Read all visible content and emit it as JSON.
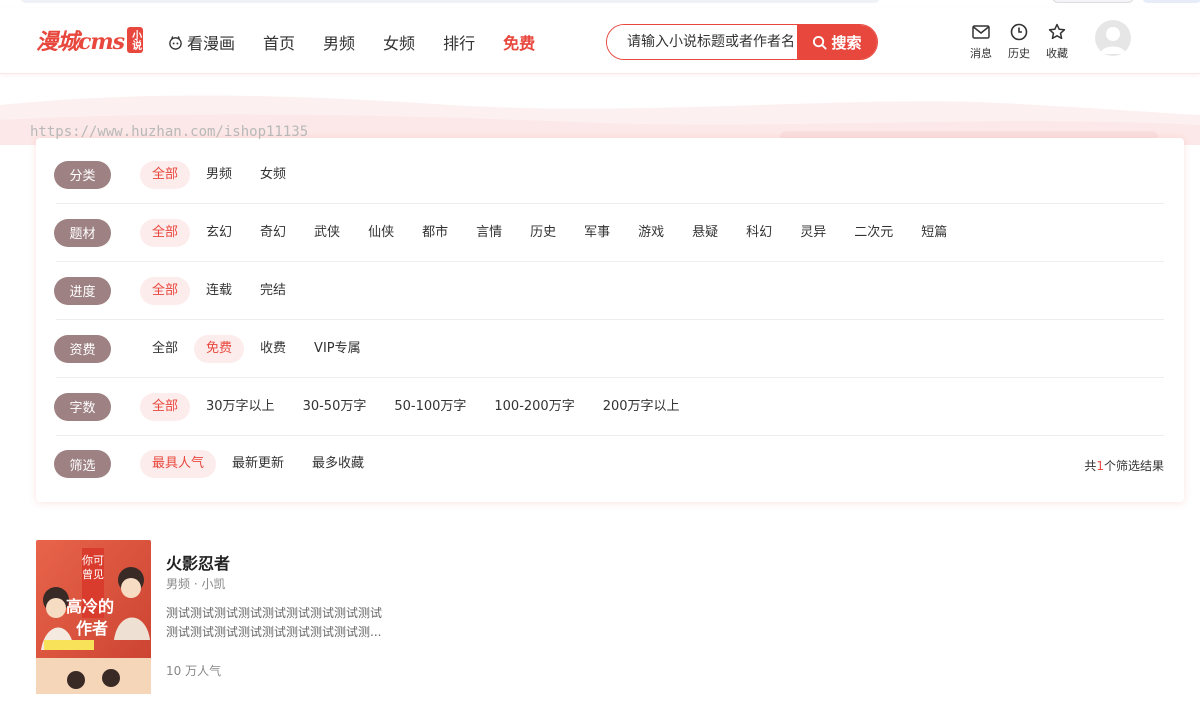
{
  "header": {
    "logo_text": "漫城cms",
    "logo_badge": "小说",
    "nav": [
      {
        "label": "看漫画",
        "icon": "comic-icon"
      },
      {
        "label": "首页"
      },
      {
        "label": "男频"
      },
      {
        "label": "女频"
      },
      {
        "label": "排行"
      },
      {
        "label": "免费",
        "active": true
      }
    ],
    "search": {
      "placeholder": "请输入小说标题或者作者名",
      "button": "搜索"
    },
    "tools": [
      {
        "label": "消息",
        "icon": "mail-icon"
      },
      {
        "label": "历史",
        "icon": "clock-icon"
      },
      {
        "label": "收藏",
        "icon": "star-icon"
      }
    ]
  },
  "watermark": "https://www.huzhan.com/ishop11135",
  "filters": {
    "category": {
      "label": "分类",
      "options": [
        "全部",
        "男频",
        "女频"
      ],
      "selected": "全部"
    },
    "theme": {
      "label": "题材",
      "options": [
        "全部",
        "玄幻",
        "奇幻",
        "武侠",
        "仙侠",
        "都市",
        "言情",
        "历史",
        "军事",
        "游戏",
        "悬疑",
        "科幻",
        "灵异",
        "二次元",
        "短篇"
      ],
      "selected": "全部"
    },
    "progress": {
      "label": "进度",
      "options": [
        "全部",
        "连载",
        "完结"
      ],
      "selected": "全部"
    },
    "fee": {
      "label": "资费",
      "options": [
        "全部",
        "免费",
        "收费",
        "VIP专属"
      ],
      "selected": "免费"
    },
    "words": {
      "label": "字数",
      "options": [
        "全部",
        "30万字以上",
        "30-50万字",
        "50-100万字",
        "100-200万字",
        "200万字以上"
      ],
      "selected": "全部"
    },
    "sort": {
      "label": "筛选",
      "options": [
        "最具人气",
        "最新更新",
        "最多收藏"
      ],
      "selected": "最具人气"
    }
  },
  "result": {
    "prefix": "共",
    "count": "1",
    "suffix": "个筛选结果"
  },
  "books": [
    {
      "title": "火影忍者",
      "meta": "男频 · 小凯",
      "desc_line1": "测试测试测试测试测试测试测试测试测试",
      "desc_line2": "测试测试测试测试测试测试测试测试测...",
      "popularity": "10 万人气",
      "cover_text": "你可曾见过如此高冷的作者"
    }
  ],
  "colors": {
    "accent": "#e8473d",
    "label_bg": "#9d8183",
    "active_bg": "#fdecec"
  }
}
